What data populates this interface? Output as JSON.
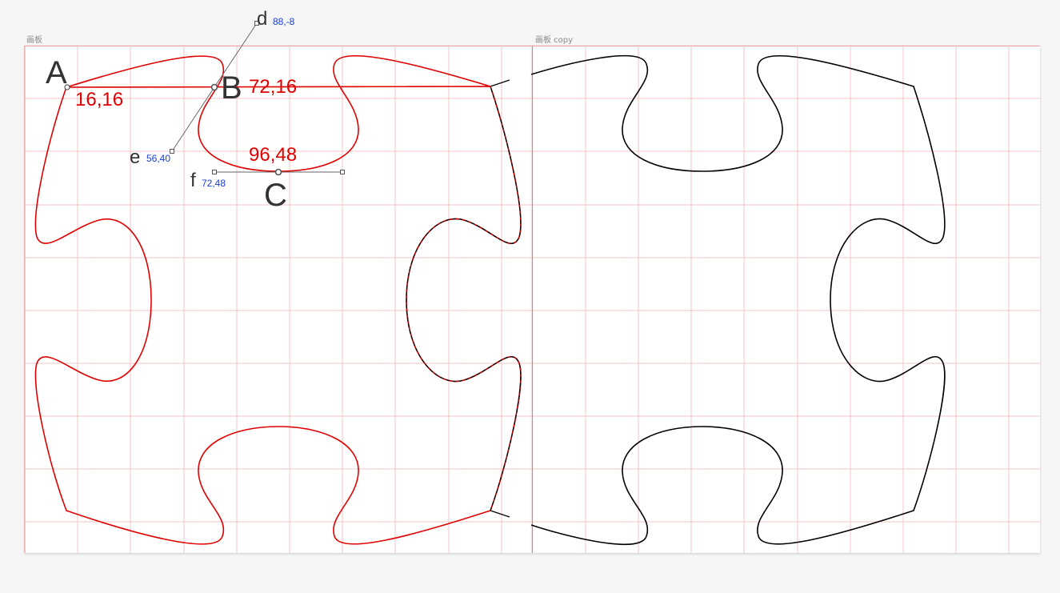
{
  "artboards": [
    {
      "name": "画板"
    },
    {
      "name": "画板 copy"
    }
  ],
  "points": {
    "A": {
      "letter": "A",
      "coord": "16,16"
    },
    "B": {
      "letter": "B",
      "coord": "72,16"
    },
    "C": {
      "letter": "C",
      "coord": "96,48"
    }
  },
  "handles": {
    "d": {
      "letter": "d",
      "coord": "88,-8"
    },
    "e": {
      "letter": "e",
      "coord": "56,40"
    },
    "f": {
      "letter": "f",
      "coord": "72,48"
    }
  },
  "colors": {
    "grid": "#f2c4c4",
    "red_path": "#e00000",
    "black_path": "#000000",
    "label_red": "#e00000",
    "label_blue": "#1a3fd6",
    "label_dark": "#333333"
  }
}
